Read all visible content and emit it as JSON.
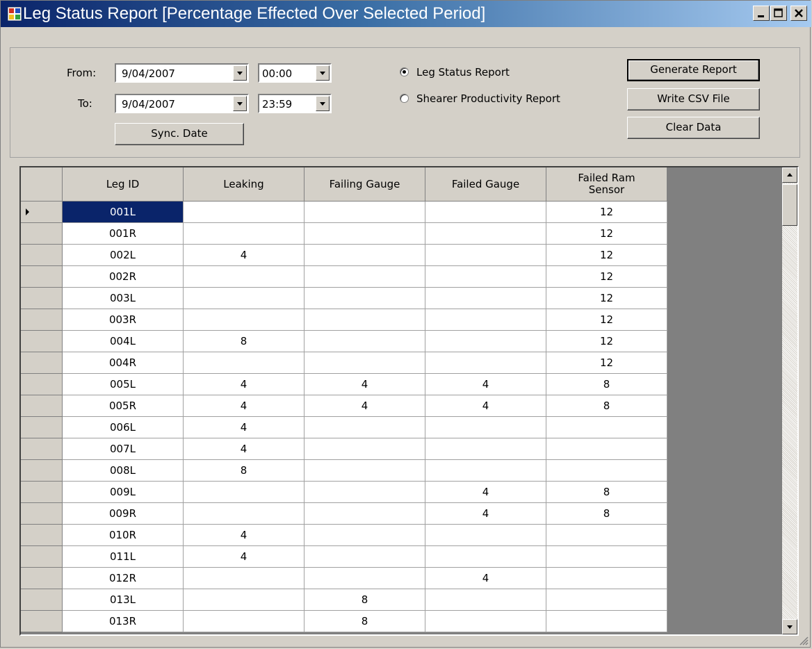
{
  "window": {
    "title": "Leg Status Report [Percentage Effected Over Selected Period]"
  },
  "filters": {
    "from_label": "From:",
    "to_label": "To:",
    "from_date": "9/04/2007",
    "from_time": "00:00",
    "to_date": "9/04/2007",
    "to_time": "23:59",
    "sync_label": "Sync. Date"
  },
  "report_type": {
    "options": [
      "Leg Status Report",
      "Shearer Productivity Report"
    ],
    "selected": "Leg Status Report"
  },
  "actions": {
    "generate": "Generate Report",
    "csv": "Write CSV File",
    "clear": "Clear Data"
  },
  "grid": {
    "columns": [
      "Leg ID",
      "Leaking",
      "Failing Gauge",
      "Failed Gauge",
      "Failed Ram Sensor"
    ],
    "selected_row": 0,
    "rows": [
      [
        "001L",
        "",
        "",
        "",
        "12"
      ],
      [
        "001R",
        "",
        "",
        "",
        "12"
      ],
      [
        "002L",
        "4",
        "",
        "",
        "12"
      ],
      [
        "002R",
        "",
        "",
        "",
        "12"
      ],
      [
        "003L",
        "",
        "",
        "",
        "12"
      ],
      [
        "003R",
        "",
        "",
        "",
        "12"
      ],
      [
        "004L",
        "8",
        "",
        "",
        "12"
      ],
      [
        "004R",
        "",
        "",
        "",
        "12"
      ],
      [
        "005L",
        "4",
        "4",
        "4",
        "8"
      ],
      [
        "005R",
        "4",
        "4",
        "4",
        "8"
      ],
      [
        "006L",
        "4",
        "",
        "",
        ""
      ],
      [
        "007L",
        "4",
        "",
        "",
        ""
      ],
      [
        "008L",
        "8",
        "",
        "",
        ""
      ],
      [
        "009L",
        "",
        "",
        "4",
        "8"
      ],
      [
        "009R",
        "",
        "",
        "4",
        "8"
      ],
      [
        "010R",
        "4",
        "",
        "",
        ""
      ],
      [
        "011L",
        "4",
        "",
        "",
        ""
      ],
      [
        "012R",
        "",
        "",
        "4",
        ""
      ],
      [
        "013L",
        "",
        "8",
        "",
        ""
      ],
      [
        "013R",
        "",
        "8",
        "",
        ""
      ]
    ]
  },
  "icons": {
    "app": "app-window-icon",
    "minimize": "minimize-icon",
    "maximize": "maximize-icon",
    "close": "close-icon",
    "row_pointer": "row-pointer-icon"
  }
}
